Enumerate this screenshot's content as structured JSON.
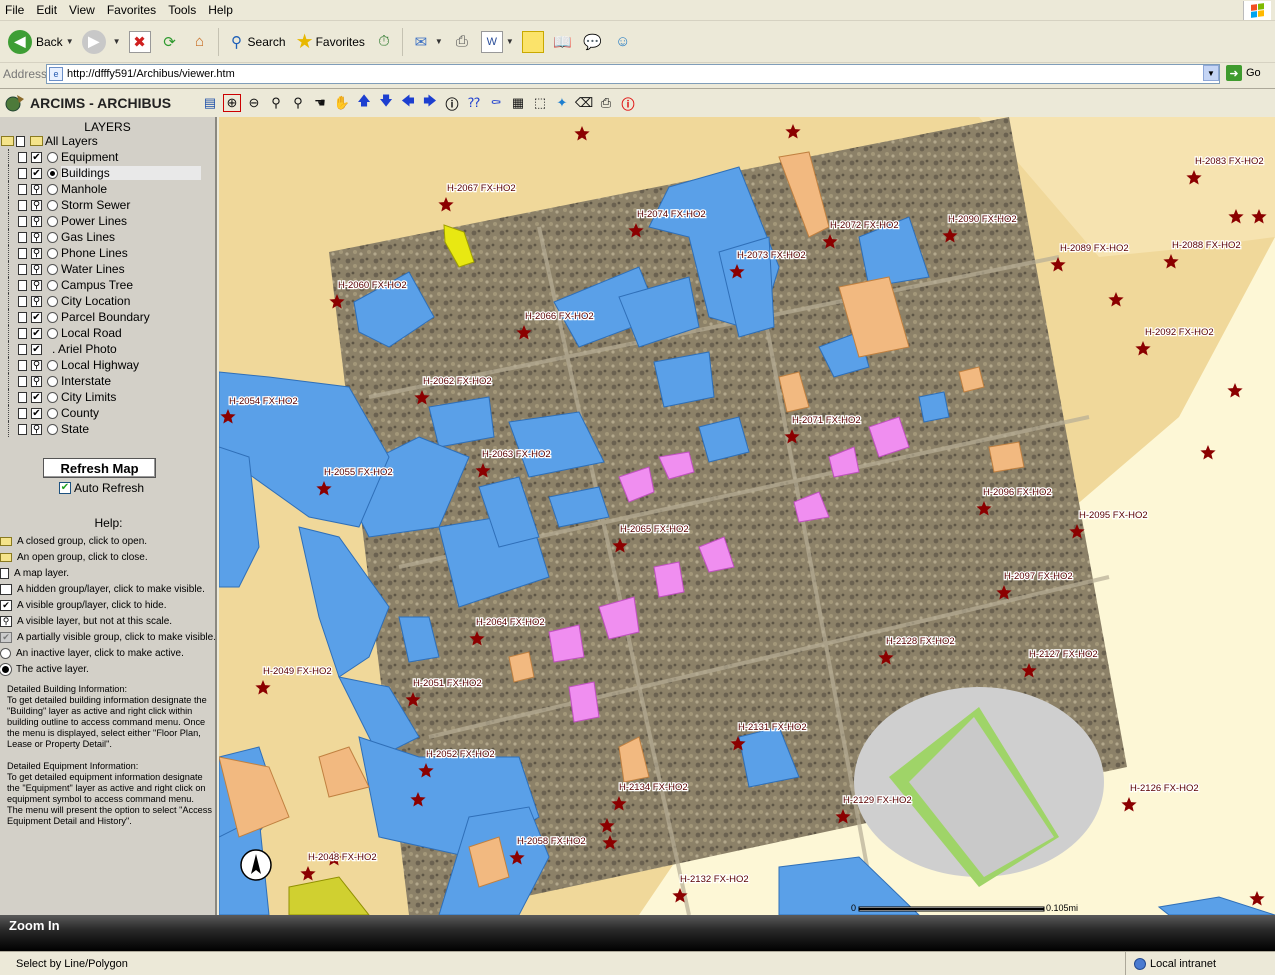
{
  "menu": [
    "File",
    "Edit",
    "View",
    "Favorites",
    "Tools",
    "Help"
  ],
  "toolbar": {
    "back": "Back",
    "search": "Search",
    "favorites": "Favorites"
  },
  "address": {
    "label": "Address",
    "url": "http://dfffy591/Archibus/viewer.htm",
    "go": "Go"
  },
  "app": {
    "title": "ARCIMS - ARCHIBUS",
    "tool_icons": [
      "legend-icon",
      "zoom-in-icon",
      "zoom-out-icon",
      "zoom-layer-icon",
      "zoom-full-icon",
      "zoom-back-icon",
      "pan-icon",
      "pan-north-icon",
      "pan-south-icon",
      "pan-west-icon",
      "pan-east-icon",
      "identify-icon",
      "query-icon",
      "find-icon",
      "measure-icon",
      "select-rectangle-icon",
      "select-line-icon",
      "clear-selection-icon",
      "print-icon",
      "info-icon"
    ]
  },
  "layers": {
    "title": "LAYERS",
    "all_label": "All Layers",
    "items": [
      {
        "name": "Equipment",
        "visible": true,
        "state": "visible",
        "active": false
      },
      {
        "name": "Buildings",
        "visible": true,
        "state": "visible",
        "active": true
      },
      {
        "name": "Manhole",
        "visible": false,
        "state": "scale",
        "active": false
      },
      {
        "name": "Storm Sewer",
        "visible": false,
        "state": "scale",
        "active": false
      },
      {
        "name": "Power Lines",
        "visible": false,
        "state": "scale",
        "active": false
      },
      {
        "name": "Gas Lines",
        "visible": false,
        "state": "scale",
        "active": false
      },
      {
        "name": "Phone Lines",
        "visible": false,
        "state": "scale",
        "active": false
      },
      {
        "name": "Water Lines",
        "visible": false,
        "state": "scale",
        "active": false
      },
      {
        "name": "Campus Tree",
        "visible": false,
        "state": "scale",
        "active": false
      },
      {
        "name": "City Location",
        "visible": false,
        "state": "scale",
        "active": false
      },
      {
        "name": "Parcel Boundary",
        "visible": true,
        "state": "visible",
        "active": false
      },
      {
        "name": "Local Road",
        "visible": true,
        "state": "visible",
        "active": false
      },
      {
        "name": "Ariel Photo",
        "visible": true,
        "state": "visible",
        "active": false
      },
      {
        "name": "Local Highway",
        "visible": false,
        "state": "scale",
        "active": false
      },
      {
        "name": "Interstate",
        "visible": false,
        "state": "scale",
        "active": false
      },
      {
        "name": "City Limits",
        "visible": true,
        "state": "visible",
        "active": false
      },
      {
        "name": "County",
        "visible": true,
        "state": "visible",
        "active": false
      },
      {
        "name": "State",
        "visible": false,
        "state": "scale",
        "active": false
      }
    ],
    "refresh_label": "Refresh Map",
    "auto_refresh_label": "Auto Refresh"
  },
  "help": {
    "title": "Help:",
    "legend": [
      "A closed group, click to open.",
      "An open group, click to close.",
      "A map layer.",
      "A hidden group/layer, click to make visible.",
      "A visible group/layer, click to hide.",
      "A visible layer, but not at this scale.",
      "A partially visible group, click to make visible.",
      "An inactive layer, click to make active.",
      "The active layer."
    ],
    "building_info": "Detailed Building Information:\nTo get detailed building information designate the \"Building\" layer as active and right click within building outline to access command menu. Once the menu is displayed, select either \"Floor Plan, Lease or Property Detail\".",
    "equipment_info": "Detailed Equipment Information:\nTo get detailed equipment information designate the \"Equipment\" layer as active and right click on equipment symbol to access command menu. The menu will present the option to select \"Access Equipment Detail and History\"."
  },
  "map": {
    "labels": [
      "H-2067 FX-HO2",
      "H-2074 FX-HO2",
      "H-2072 FX-HO2",
      "H-2090 FX-HO2",
      "H-2083 FX-HO2",
      "H-2073 FX-HO2",
      "H-2089 FX-HO2",
      "H-2088 FX-HO2",
      "H-2060 FX-HO2",
      "H-2066 FX-HO2",
      "H-2092 FX-HO2",
      "H-2062 FX-HO2",
      "H-2054 FX-HO2",
      "H-2071 FX-HO2",
      "H-2063 FX-HO2",
      "H-2055 FX-HO2",
      "H-2096 FX-HO2",
      "H-2095 FX-HO2",
      "H-2065 FX-HO2",
      "H-2097 FX-HO2",
      "H-2064 FX-HO2",
      "H-2128 FX-HO2",
      "H-2127 FX-HO2",
      "H-2049 FX-HO2",
      "H-2051 FX-HO2",
      "H-2131 FX-HO2",
      "H-2052 FX-HO2",
      "H-2134 FX-HO2",
      "H-2126 FX-HO2",
      "H-2129 FX-HO2",
      "H-2058 FX-HO2",
      "H-2048 FX-HO2",
      "H-2132 FX-HO2"
    ],
    "scale_start": "0",
    "scale_end": "0.105mi",
    "colors": {
      "land": "#f0d89a",
      "building": "#5aa0e8",
      "highlight": "#f08ef0",
      "marker": "#8b0000",
      "photo": "#8c8168"
    }
  },
  "zoom_mode": "Zoom In",
  "status": {
    "text": "Select by Line/Polygon",
    "zone": "Local intranet"
  }
}
